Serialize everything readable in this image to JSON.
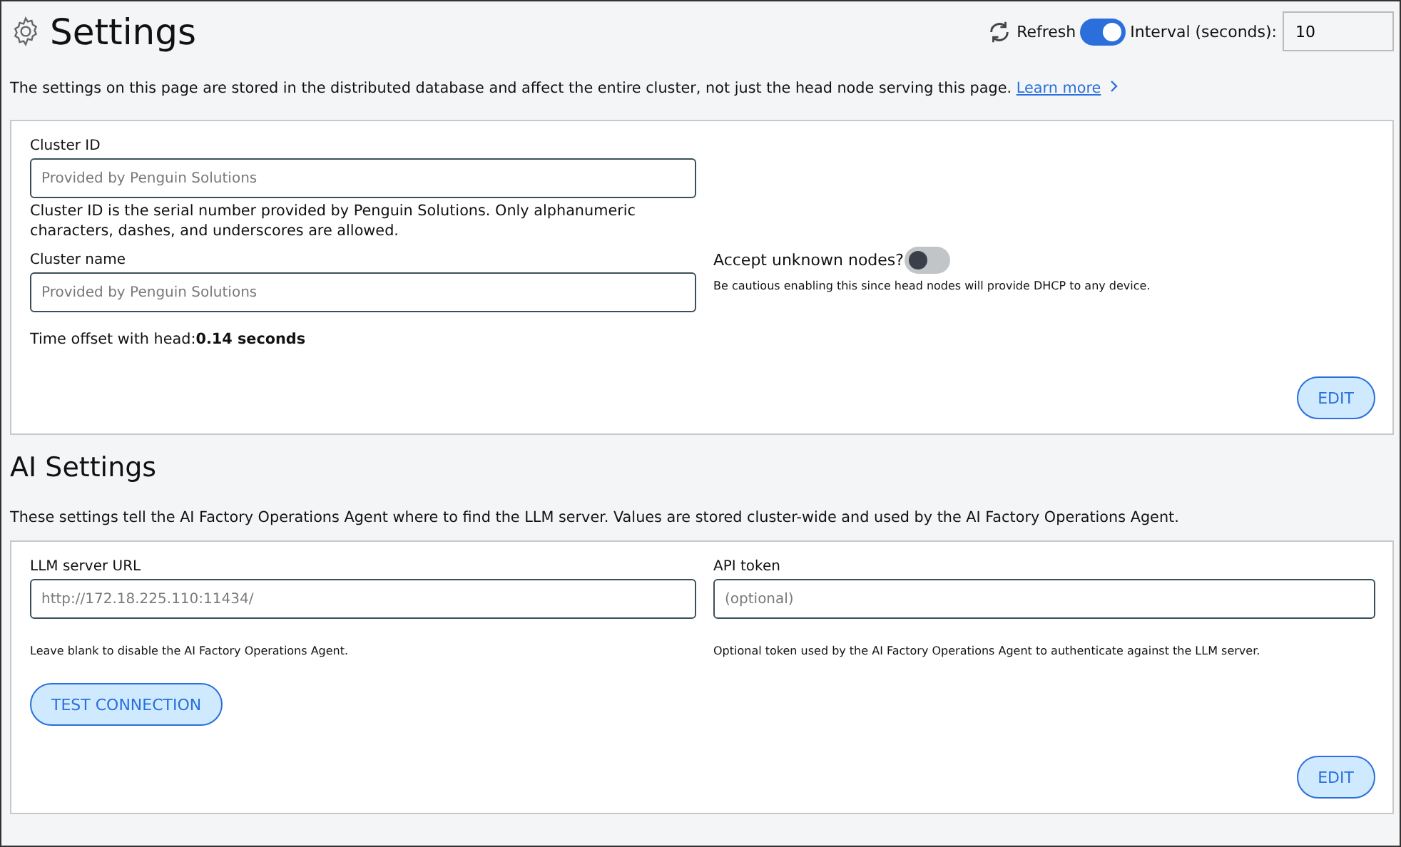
{
  "header": {
    "title": "Settings",
    "refresh_label": "Refresh",
    "auto_refresh": {
      "on": true
    },
    "interval_label": "Interval (seconds):",
    "interval_value": "10"
  },
  "notice": {
    "text": "The settings on this page are stored in the distributed database and affect the entire cluster, not just the head node serving this page.",
    "link": "Learn more"
  },
  "cluster": {
    "cluster_id": {
      "label": "Cluster ID",
      "placeholder": "Provided by Penguin Solutions",
      "help": "Cluster ID is the serial number provided by Penguin Solutions. Only alphanumeric characters, dashes, and underscores are allowed."
    },
    "cluster_name": {
      "label": "Cluster name",
      "placeholder": "Provided by Penguin Solutions"
    },
    "accept_unknown": {
      "label": "Accept unknown nodes?",
      "on": false,
      "help": "Be cautious enabling this since head nodes will provide DHCP to any device."
    },
    "time_offset": "Time offset with head:**0.14 seconds**",
    "edit": "EDIT"
  },
  "ai": {
    "title": "AI Settings",
    "description": "These settings tell the AI Factory Operations Agent where to find the LLM server. Values are stored cluster-wide and used by the AI Factory Operations Agent.",
    "llm_url": {
      "label": "LLM server URL",
      "placeholder": "http://172.18.225.110:11434/",
      "help": "Leave blank to disable the AI Factory Operations Agent."
    },
    "api_token": {
      "label": "API token",
      "placeholder": "(optional)",
      "help": "Optional token used by the AI Factory Operations Agent to authenticate against the LLM server."
    },
    "test": "TEST CONNECTION",
    "edit": "EDIT"
  }
}
